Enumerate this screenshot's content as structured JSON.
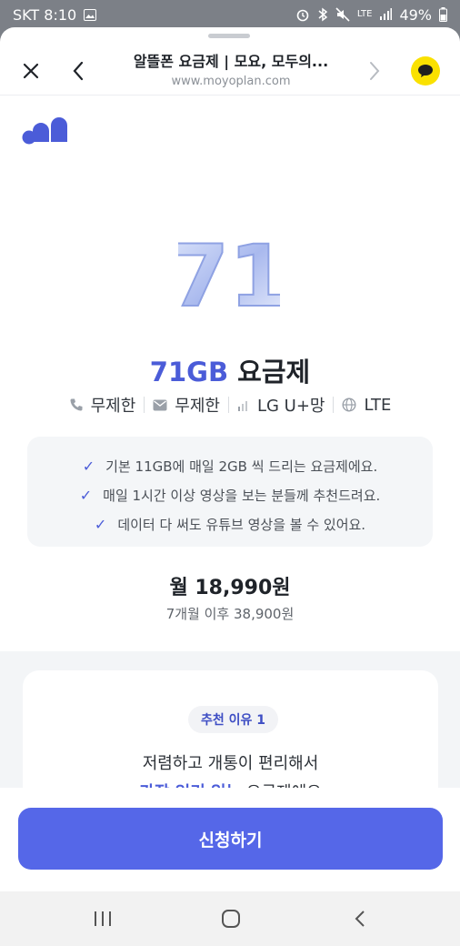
{
  "status_bar": {
    "carrier_time": "SKT 8:10",
    "network": "LTE",
    "battery": "49%"
  },
  "browser": {
    "title": "알뜰폰 요금제 | 모요, 모두의...",
    "url": "www.moyoplan.com"
  },
  "plan": {
    "hero_number": "71",
    "title_accent": "71GB",
    "title_rest": " 요금제",
    "specs": [
      {
        "icon": "phone-icon",
        "label": "무제한"
      },
      {
        "icon": "mail-icon",
        "label": "무제한"
      },
      {
        "icon": "signal-icon",
        "label": "LG U+망"
      },
      {
        "icon": "globe-icon",
        "label": "LTE"
      }
    ],
    "benefits": [
      "기본 11GB에 매일 2GB 씩 드리는 요금제에요.",
      "매일 1시간 이상 영상을 보는 분들께 추천드려요.",
      "데이터 다 써도 유튜브 영상을 볼 수 있어요."
    ],
    "price": "월 18,990원",
    "price_after": "7개월 이후 38,900원"
  },
  "reason": {
    "badge": "추천 이유 1",
    "line1": "저렴하고 개통이 편리해서",
    "line2_accent": "가장 인기 있는",
    "line2_rest": " 요금제에요"
  },
  "cta": {
    "label": "신청하기"
  },
  "colors": {
    "accent": "#4b5cd8",
    "button": "#5567e8",
    "kakao": "#fae100"
  }
}
